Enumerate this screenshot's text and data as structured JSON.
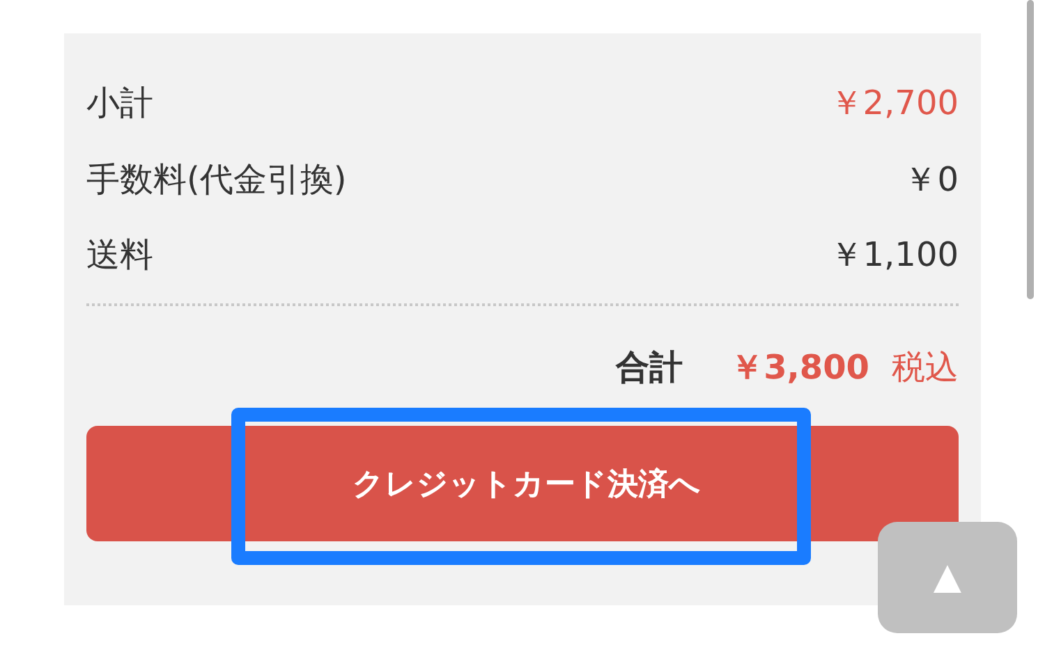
{
  "summary": {
    "rows": [
      {
        "label": "小計",
        "value": "￥2,700",
        "emphasized": true
      },
      {
        "label": "手数料(代金引換)",
        "value": "￥0",
        "emphasized": false
      },
      {
        "label": "送料",
        "value": "￥1,100",
        "emphasized": false
      }
    ],
    "total": {
      "label": "合計",
      "value": "￥3,800",
      "note": "税込"
    }
  },
  "checkout_button": {
    "label": "クレジットカード決済へ",
    "highlighted": true
  },
  "scroll_top_button": {
    "label": "▲"
  }
}
